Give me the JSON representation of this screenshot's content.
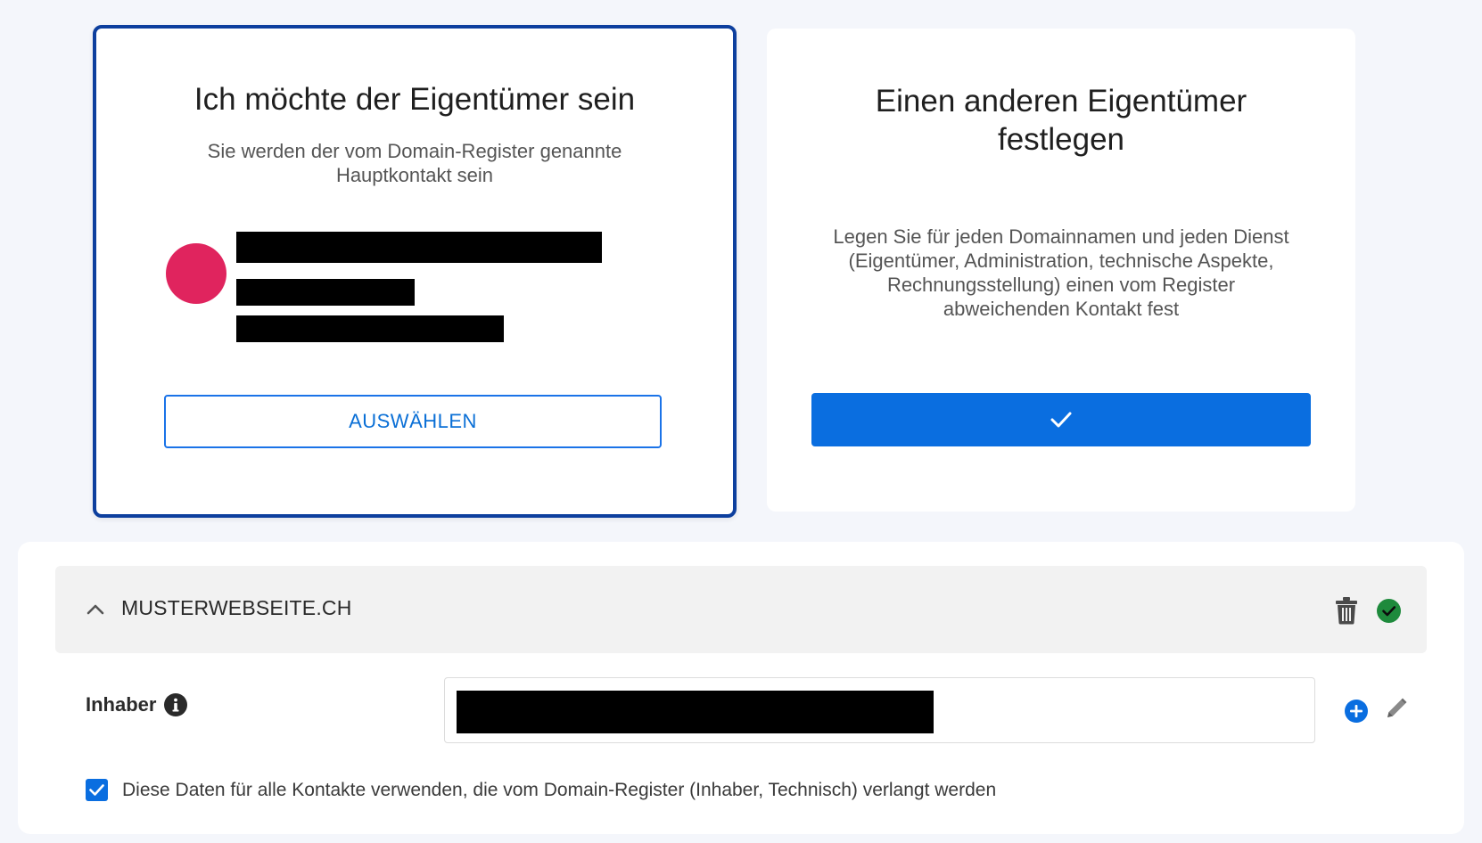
{
  "owner_self": {
    "title": "Ich möchte der Eigentümer sein",
    "subtitle_line1": "Sie werden der vom Domain-Register genannte",
    "subtitle_line2": "Hauptkontakt sein",
    "button_label": "AUSWÄHLEN",
    "avatar_color": "#e0245e",
    "selected": true
  },
  "owner_other": {
    "title_line1": "Einen anderen Eigentümer",
    "title_line2": "festlegen",
    "description_line1": "Legen Sie für jeden Domainnamen und jeden Dienst",
    "description_line2": "(Eigentümer, Administration, technische Aspekte,",
    "description_line3": "Rechnungsstellung) einen vom Register",
    "description_line4": "abweichenden Kontakt fest",
    "button_icon": "checkmark-icon"
  },
  "domain_section": {
    "domain_name": "MUSTERWEBSEITE.CH",
    "expanded": true,
    "icons": [
      "chevron-up-icon",
      "trash-icon",
      "check-circle-icon"
    ],
    "owner_field_label": "Inhaber",
    "owner_field_icons": [
      "info-icon",
      "plus-circle-icon",
      "pencil-icon"
    ],
    "use_for_all_checked": true,
    "use_for_all_label": "Diese Daten für alle Kontakte verwenden, die vom Domain-Register (Inhaber, Technisch) verlangt werden"
  },
  "colors": {
    "primary_blue": "#0a6ee0",
    "selected_border": "#0d3f9e",
    "success_green": "#1e8a3c",
    "background": "#f4f6fb"
  }
}
